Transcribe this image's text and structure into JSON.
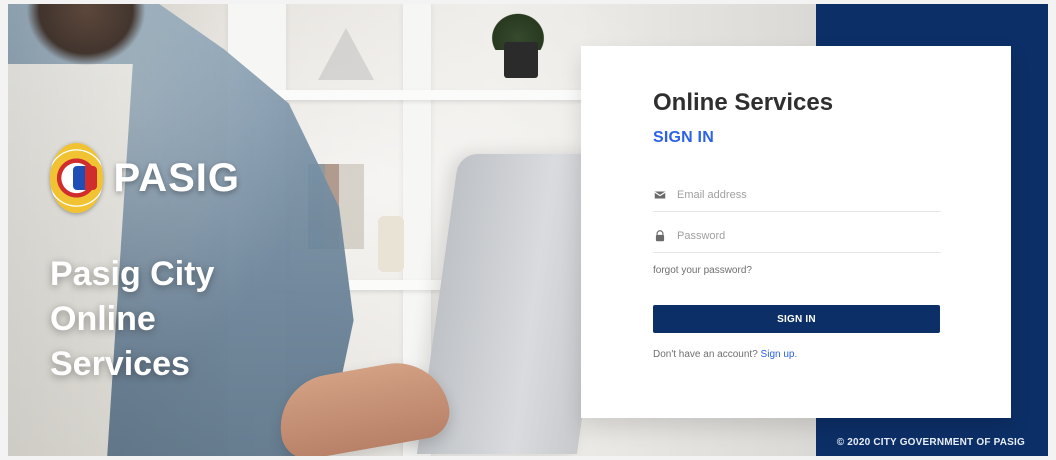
{
  "hero": {
    "brand_logo_text": "PASIG",
    "headline_line1": "Pasig City",
    "headline_line2": "Online",
    "headline_line3": "Services"
  },
  "login_card": {
    "title": "Online Services",
    "subtitle": "SIGN IN",
    "email": {
      "placeholder": "Email address",
      "value": ""
    },
    "password": {
      "placeholder": "Password",
      "value": ""
    },
    "forgot_password_label": "forgot your password?",
    "sign_in_button_label": "SIGN IN",
    "no_account_text": "Don't have an account?",
    "sign_up_link_label": "Sign up."
  },
  "footer": {
    "copyright": "© 2020 CITY GOVERNMENT OF PASIG"
  },
  "icons": {
    "email_icon": "envelope-icon",
    "password_icon": "lock-icon"
  },
  "colors": {
    "primary_navy": "#0c2f67",
    "accent_blue": "#2c62e8"
  }
}
